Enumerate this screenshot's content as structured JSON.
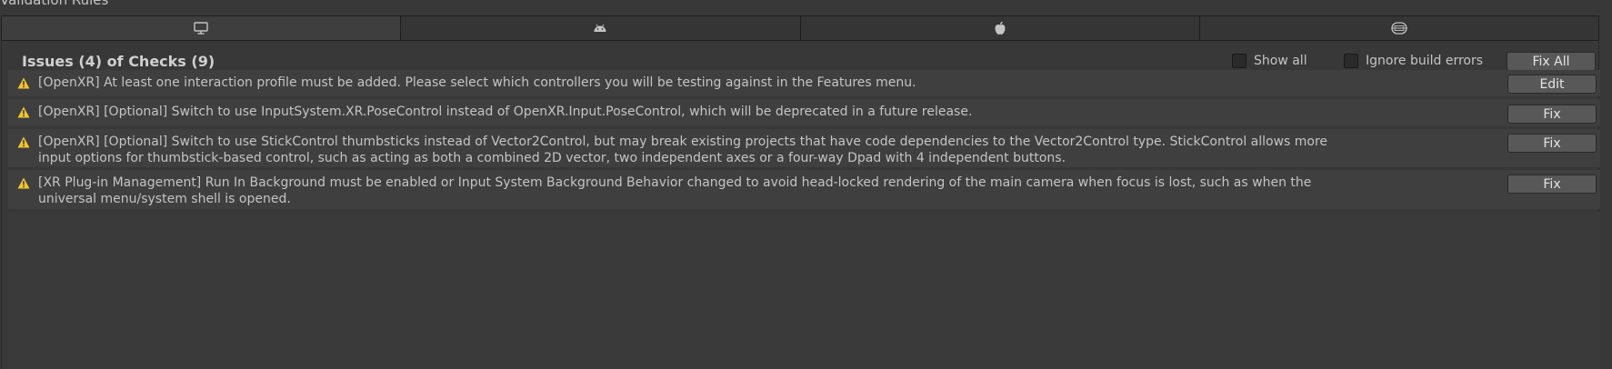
{
  "window": {
    "title": "Validation Rules"
  },
  "tabs": [
    {
      "icon": "monitor-icon",
      "active": true
    },
    {
      "icon": "android-icon",
      "active": false
    },
    {
      "icon": "apple-icon",
      "active": false
    },
    {
      "icon": "webgl-icon",
      "active": false
    }
  ],
  "header": {
    "title": "Issues (4) of Checks (9)",
    "show_all_label": "Show all",
    "ignore_build_errors_label": "Ignore build errors",
    "fix_all_label": "Fix All"
  },
  "issues": [
    {
      "icon": "warning-icon",
      "text": "[OpenXR] At least one interaction profile must be added.  Please select which controllers you will be testing against in the Features menu.",
      "action": "Edit"
    },
    {
      "icon": "warning-icon",
      "text": "[OpenXR] [Optional] Switch to use InputSystem.XR.PoseControl instead of OpenXR.Input.PoseControl, which will be deprecated in a future release.",
      "action": "Fix"
    },
    {
      "icon": "warning-icon",
      "text": "[OpenXR] [Optional] Switch to use StickControl thumbsticks instead of Vector2Control, but may break existing projects that have code dependencies to the Vector2Control type. StickControl allows more input options for thumbstick-based control, such as acting as both a combined 2D vector, two independent axes or a four-way Dpad with 4 independent buttons.",
      "action": "Fix"
    },
    {
      "icon": "warning-icon",
      "text": "[XR Plug-in Management] Run In Background must be enabled or Input System Background Behavior changed to avoid head-locked rendering of the main camera when focus is lost, such as when the universal menu/system shell is opened.",
      "action": "Fix"
    }
  ],
  "colors": {
    "warning": "#f4c430",
    "button": "#585858",
    "row": "#3f3f3f",
    "background": "#383838"
  }
}
